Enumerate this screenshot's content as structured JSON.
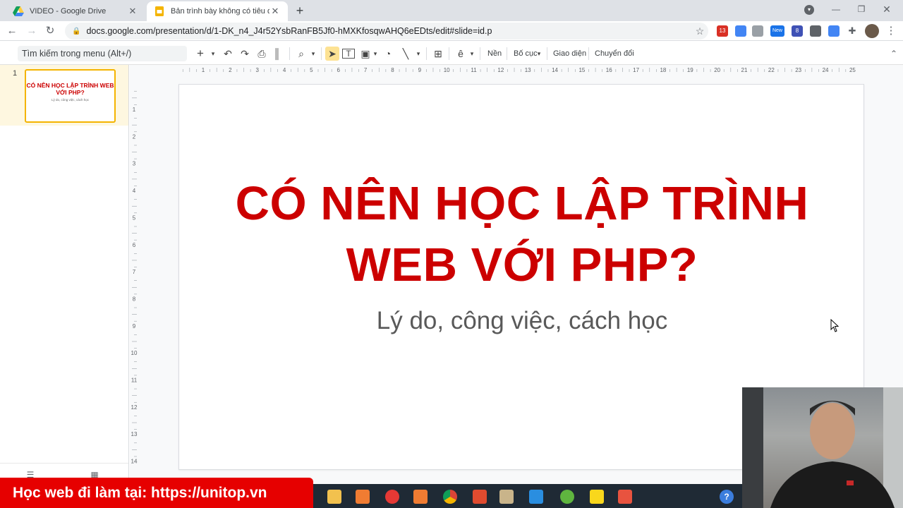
{
  "browser": {
    "tabs": [
      {
        "title": "VIDEO - Google Drive",
        "active": false,
        "favicon": "google-drive-icon"
      },
      {
        "title": "Bản trình bày không có tiêu đề -",
        "active": true,
        "favicon": "google-slides-icon"
      }
    ],
    "url": "docs.google.com/presentation/d/1-DK_n4_J4r52YsbRanFB5Jf0-hMXKfosqwAHQ6eEDts/edit#slide=id.p",
    "extension_badges": {
      "calendar": "13",
      "new": "New",
      "gear": "8"
    }
  },
  "toolbar": {
    "menu_search_placeholder": "Tìm kiếm trong menu (Alt+/)",
    "background_label": "Nền",
    "layout_label": "Bố cục",
    "theme_label": "Giao diện",
    "transition_label": "Chuyển đổi"
  },
  "ruler": {
    "horizontal_ticks": [
      "1",
      "2",
      "3",
      "4",
      "5",
      "6",
      "7",
      "8",
      "9",
      "10",
      "11",
      "12",
      "13",
      "14",
      "15",
      "16",
      "17",
      "18",
      "19",
      "20",
      "21",
      "22",
      "23",
      "24",
      "25"
    ],
    "vertical_ticks": [
      "1",
      "2",
      "3",
      "4",
      "5",
      "6",
      "7",
      "8",
      "9",
      "10",
      "11",
      "12",
      "13",
      "14"
    ]
  },
  "filmstrip": {
    "slides": [
      {
        "number": "1",
        "title": "CÓ NÊN HỌC LẬP TRÌNH WEB VỚI PHP?",
        "subtitle": "Lý do, công việc, cách học"
      }
    ]
  },
  "slide": {
    "title": "CÓ NÊN HỌC LẬP TRÌNH WEB VỚI PHP?",
    "subtitle": "Lý do, công việc, cách học"
  },
  "overlay": {
    "banner": "Học web đi làm tại: https://unitop.vn"
  },
  "colors": {
    "title_red": "#cc0000",
    "banner_red": "#e60000",
    "selection_yellow": "#f4b400"
  }
}
